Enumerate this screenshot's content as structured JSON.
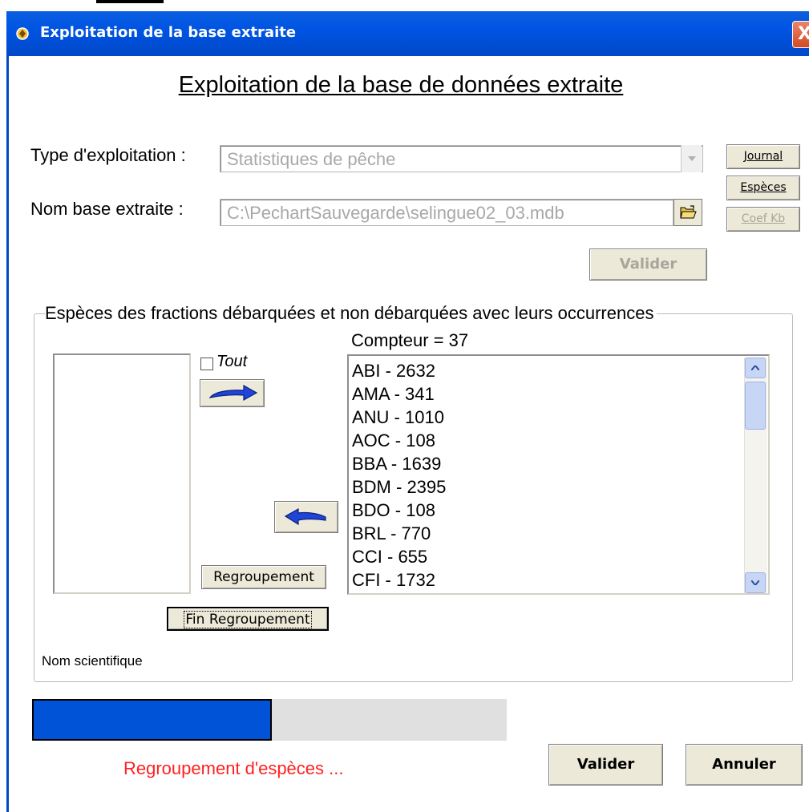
{
  "window": {
    "title": "Exploitation de la base extraite",
    "close_label": "X"
  },
  "heading": "Exploitation de la base de données extraite",
  "form": {
    "type_label": "Type d'exploitation :",
    "type_value": "Statistiques de pêche",
    "base_label": "Nom base extraite :",
    "base_value": "C:\\PechartSauvegarde\\selingue02_03.mdb"
  },
  "side_buttons": {
    "journal": "Journal",
    "especes": "Espèces",
    "coef": "Coef Kb"
  },
  "validate_top": "Valider",
  "group": {
    "legend": "Espèces des fractions débarquées et non débarquées avec leurs occurrences",
    "counter": "Compteur = 37",
    "tout_label": "Tout",
    "regroupement": "Regroupement",
    "fin_regroupement": "Fin Regroupement",
    "nom_scientifique": "Nom scientifique",
    "species": [
      "ABI - 2632",
      "AMA - 341",
      "ANU - 1010",
      "AOC - 108",
      "BBA - 1639",
      "BDM - 2395",
      "BDO - 108",
      "BRL - 770",
      "CCI - 655",
      "CFI - 1732"
    ]
  },
  "progress": {
    "fraction": 0.505
  },
  "status_text": "Regroupement d'espèces ...",
  "bottom": {
    "validate": "Valider",
    "cancel": "Annuler"
  },
  "colors": {
    "titlebar": "#0054e3",
    "progress": "#0053d6",
    "status": "#ff2020",
    "arrow": "#1f44d8"
  }
}
